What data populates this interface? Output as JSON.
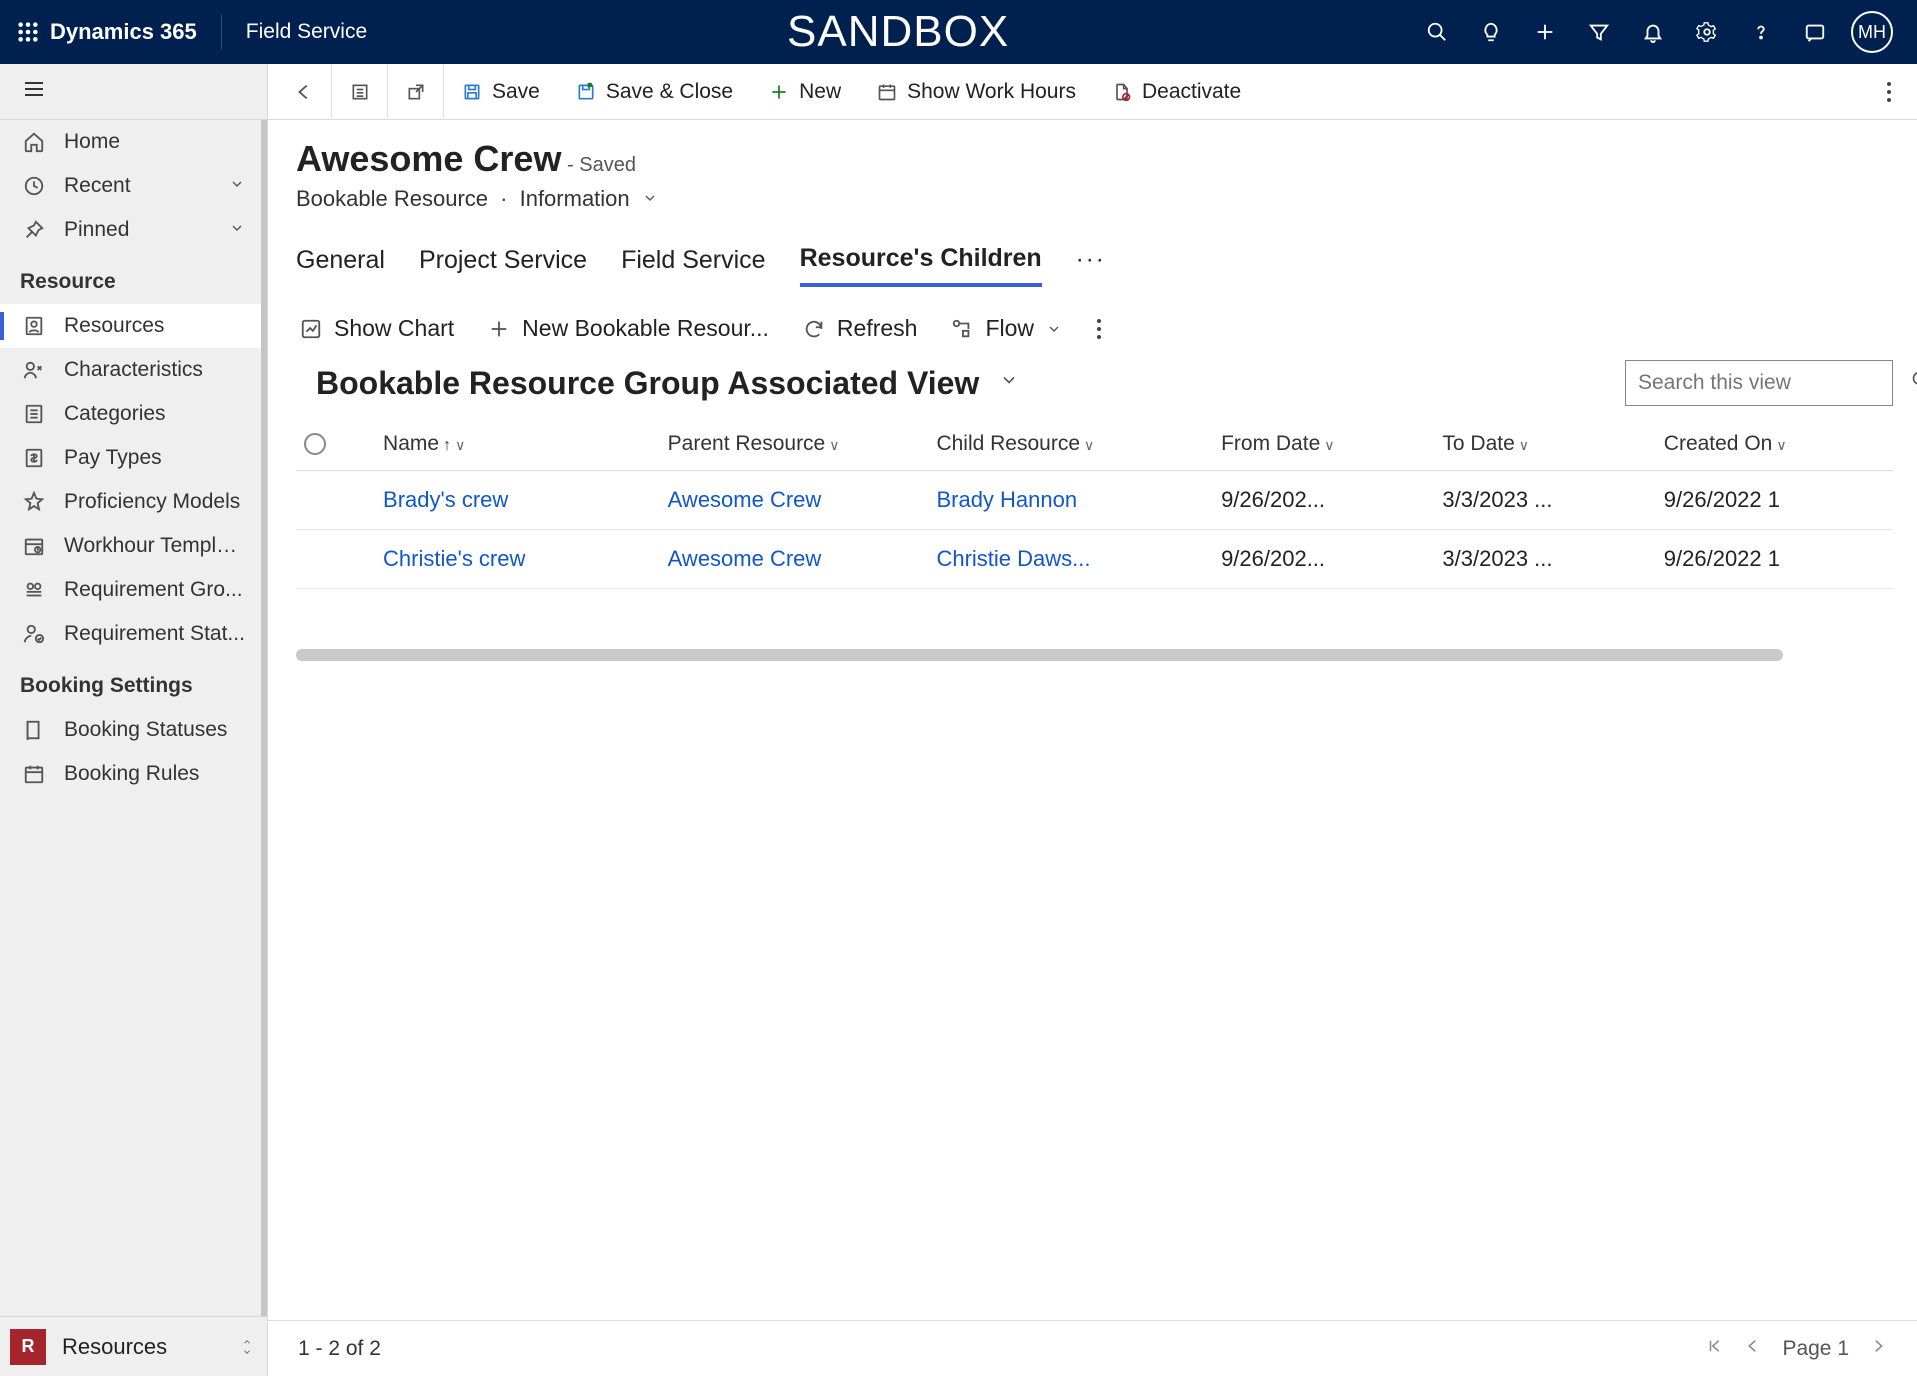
{
  "header": {
    "brand": "Dynamics 365",
    "module": "Field Service",
    "env_label": "SANDBOX",
    "avatar_initials": "MH"
  },
  "sidebar": {
    "home": "Home",
    "recent": "Recent",
    "pinned": "Pinned",
    "groups": [
      {
        "label": "Resource",
        "items": [
          "Resources",
          "Characteristics",
          "Categories",
          "Pay Types",
          "Proficiency Models",
          "Workhour Templa...",
          "Requirement Gro...",
          "Requirement Stat..."
        ],
        "active_index": 0
      },
      {
        "label": "Booking Settings",
        "items": [
          "Booking Statuses",
          "Booking Rules"
        ]
      }
    ],
    "area": {
      "badge": "R",
      "label": "Resources"
    }
  },
  "commandbar": {
    "save": "Save",
    "save_close": "Save & Close",
    "new": "New",
    "show_hours": "Show Work Hours",
    "deactivate": "Deactivate"
  },
  "record": {
    "title": "Awesome Crew",
    "status": "- Saved",
    "entity": "Bookable Resource",
    "form": "Information",
    "tabs": [
      "General",
      "Project Service",
      "Field Service",
      "Resource's Children"
    ],
    "active_tab": 3
  },
  "subgrid": {
    "buttons": {
      "show_chart": "Show Chart",
      "new_row": "New Bookable Resour...",
      "refresh": "Refresh",
      "flow": "Flow"
    },
    "view": "Bookable Resource Group Associated View",
    "search_placeholder": "Search this view",
    "columns": [
      "Name",
      "Parent Resource",
      "Child Resource",
      "From Date",
      "To Date",
      "Created On"
    ],
    "rows": [
      {
        "name": "Brady's crew",
        "parent": "Awesome Crew",
        "child": "Brady Hannon",
        "from": "9/26/202...",
        "to": "3/3/2023 ...",
        "created": "9/26/2022 1"
      },
      {
        "name": "Christie's crew",
        "parent": "Awesome Crew",
        "child": "Christie Daws...",
        "from": "9/26/202...",
        "to": "3/3/2023 ...",
        "created": "9/26/2022 1"
      }
    ]
  },
  "footer": {
    "count": "1 - 2 of 2",
    "page": "Page 1"
  }
}
